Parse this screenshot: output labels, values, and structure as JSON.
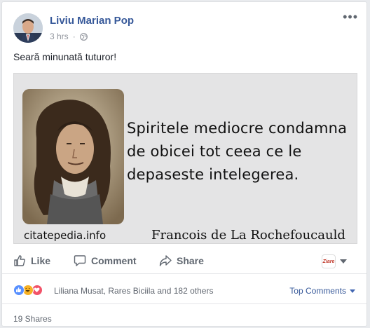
{
  "post": {
    "author": "Liviu Marian Pop",
    "time": "3 hrs",
    "dot": "·",
    "privacy_icon": "globe-icon",
    "more_icon": "more-options-icon",
    "more_glyph": "•••",
    "text": "Seară minunată tuturor!"
  },
  "image": {
    "quote_lines": [
      "Spiritele mediocre condamna",
      "de obicei tot ceea ce le",
      "depaseste intelegerea."
    ],
    "site": "citatepedia.info",
    "attribution": "Francois de La Rochefoucauld"
  },
  "actions": {
    "like_label": "Like",
    "comment_label": "Comment",
    "share_label": "Share",
    "share_target_badge": "Ziare"
  },
  "reactions": {
    "icons": [
      "like-reaction-icon",
      "haha-reaction-icon",
      "love-reaction-icon"
    ],
    "text": "Liliana Musat, Rares Biciila and 182 others",
    "sort_label": "Top Comments"
  },
  "shares": {
    "text": "19 Shares"
  },
  "colors": {
    "link": "#365899",
    "muted": "#90949c",
    "action": "#606770",
    "like": "#5890ff",
    "haha": "#f7b125",
    "love": "#f25268"
  }
}
